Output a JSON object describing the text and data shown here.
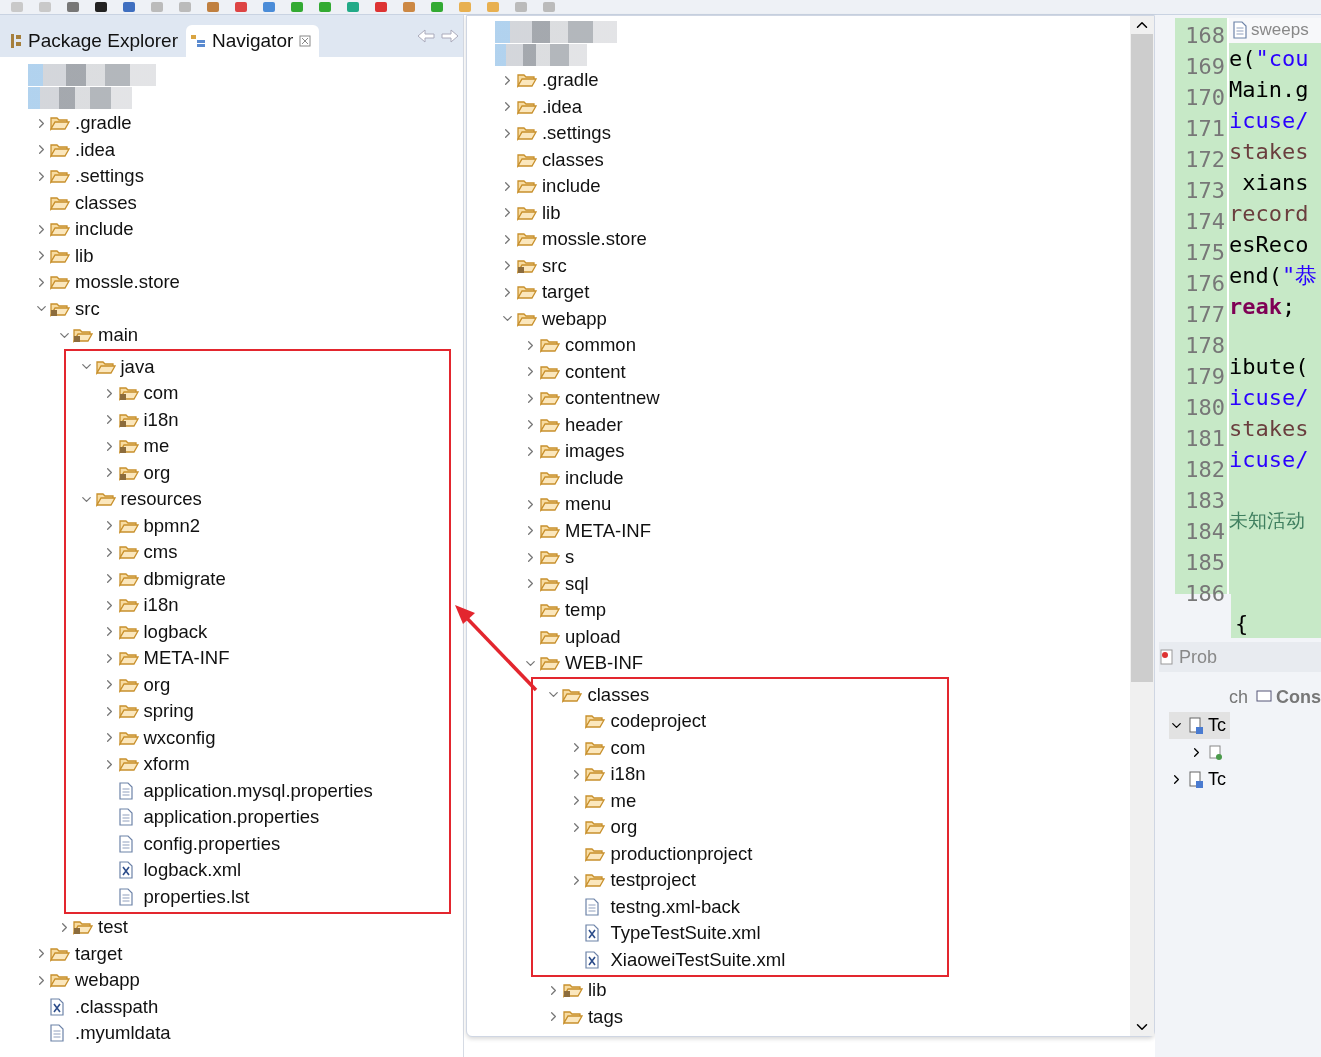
{
  "left_panel": {
    "tabs": [
      {
        "label": "Package Explorer",
        "selected": false
      },
      {
        "label": "Navigator",
        "selected": true
      }
    ],
    "redacted_rows": [
      {
        "kind": "project"
      },
      {
        "kind": "path"
      }
    ],
    "tree": [
      {
        "label": ".gradle",
        "kind": "folder",
        "expanded": false
      },
      {
        "label": ".idea",
        "kind": "folder",
        "expanded": false
      },
      {
        "label": ".settings",
        "kind": "folder",
        "expanded": false
      },
      {
        "label": "classes",
        "kind": "folder"
      },
      {
        "label": "include",
        "kind": "folder",
        "expanded": false
      },
      {
        "label": "lib",
        "kind": "folder",
        "expanded": false
      },
      {
        "label": "mossle.store",
        "kind": "folder",
        "expanded": false
      },
      {
        "label": "src",
        "kind": "source_folder",
        "expanded": true,
        "children": [
          {
            "label": "main",
            "kind": "source_folder",
            "expanded": true,
            "children": [
              {
                "label": "java",
                "kind": "folder",
                "expanded": true,
                "highlighted": true,
                "children": [
                  {
                    "label": "com",
                    "kind": "source_folder",
                    "expanded": false
                  },
                  {
                    "label": "i18n",
                    "kind": "source_folder",
                    "expanded": false
                  },
                  {
                    "label": "me",
                    "kind": "source_folder",
                    "expanded": false
                  },
                  {
                    "label": "org",
                    "kind": "source_folder",
                    "expanded": false
                  }
                ]
              },
              {
                "label": "resources",
                "kind": "folder",
                "expanded": true,
                "highlighted": true,
                "children": [
                  {
                    "label": "bpmn2",
                    "kind": "folder",
                    "expanded": false
                  },
                  {
                    "label": "cms",
                    "kind": "folder",
                    "expanded": false
                  },
                  {
                    "label": "dbmigrate",
                    "kind": "folder",
                    "expanded": false
                  },
                  {
                    "label": "i18n",
                    "kind": "folder",
                    "expanded": false
                  },
                  {
                    "label": "logback",
                    "kind": "folder",
                    "expanded": false
                  },
                  {
                    "label": "META-INF",
                    "kind": "folder",
                    "expanded": false
                  },
                  {
                    "label": "org",
                    "kind": "folder",
                    "expanded": false
                  },
                  {
                    "label": "spring",
                    "kind": "folder",
                    "expanded": false
                  },
                  {
                    "label": "wxconfig",
                    "kind": "folder",
                    "expanded": false
                  },
                  {
                    "label": "xform",
                    "kind": "folder",
                    "expanded": false
                  },
                  {
                    "label": "application.mysql.properties",
                    "kind": "file"
                  },
                  {
                    "label": "application.properties",
                    "kind": "file"
                  },
                  {
                    "label": "config.properties",
                    "kind": "file"
                  },
                  {
                    "label": "logback.xml",
                    "kind": "xml_file"
                  },
                  {
                    "label": "properties.lst",
                    "kind": "file"
                  }
                ]
              }
            ]
          },
          {
            "label": "test",
            "kind": "source_folder",
            "expanded": false
          }
        ]
      },
      {
        "label": "target",
        "kind": "folder",
        "expanded": false
      },
      {
        "label": "webapp",
        "kind": "folder",
        "expanded": false
      },
      {
        "label": ".classpath",
        "kind": "xml_file"
      },
      {
        "label": ".myumldata",
        "kind": "file"
      }
    ]
  },
  "navigator_window": {
    "redacted_rows": [
      {
        "kind": "project"
      },
      {
        "kind": "path"
      }
    ],
    "tree": [
      {
        "label": ".gradle",
        "kind": "folder",
        "expanded": false
      },
      {
        "label": ".idea",
        "kind": "folder",
        "expanded": false
      },
      {
        "label": ".settings",
        "kind": "folder",
        "expanded": false
      },
      {
        "label": "classes",
        "kind": "folder"
      },
      {
        "label": "include",
        "kind": "folder",
        "expanded": false
      },
      {
        "label": "lib",
        "kind": "folder",
        "expanded": false
      },
      {
        "label": "mossle.store",
        "kind": "folder",
        "expanded": false
      },
      {
        "label": "src",
        "kind": "source_folder",
        "expanded": false
      },
      {
        "label": "target",
        "kind": "folder",
        "expanded": false
      },
      {
        "label": "webapp",
        "kind": "folder",
        "expanded": true,
        "children": [
          {
            "label": "common",
            "kind": "folder",
            "expanded": false
          },
          {
            "label": "content",
            "kind": "folder",
            "expanded": false
          },
          {
            "label": "contentnew",
            "kind": "folder",
            "expanded": false
          },
          {
            "label": "header",
            "kind": "folder",
            "expanded": false
          },
          {
            "label": "images",
            "kind": "folder",
            "expanded": false
          },
          {
            "label": "include",
            "kind": "folder"
          },
          {
            "label": "menu",
            "kind": "folder",
            "expanded": false
          },
          {
            "label": "META-INF",
            "kind": "folder",
            "expanded": false
          },
          {
            "label": "s",
            "kind": "folder",
            "expanded": false
          },
          {
            "label": "sql",
            "kind": "folder",
            "expanded": false
          },
          {
            "label": "temp",
            "kind": "folder"
          },
          {
            "label": "upload",
            "kind": "folder"
          },
          {
            "label": "WEB-INF",
            "kind": "folder",
            "expanded": true,
            "children": [
              {
                "label": "classes",
                "kind": "folder",
                "expanded": true,
                "highlighted": true,
                "children": [
                  {
                    "label": "codeproject",
                    "kind": "folder"
                  },
                  {
                    "label": "com",
                    "kind": "folder",
                    "expanded": false
                  },
                  {
                    "label": "i18n",
                    "kind": "folder",
                    "expanded": false
                  },
                  {
                    "label": "me",
                    "kind": "folder",
                    "expanded": false
                  },
                  {
                    "label": "org",
                    "kind": "folder",
                    "expanded": false
                  },
                  {
                    "label": "productionproject",
                    "kind": "folder"
                  },
                  {
                    "label": "testproject",
                    "kind": "folder",
                    "expanded": false
                  },
                  {
                    "label": "testng.xml-back",
                    "kind": "file"
                  },
                  {
                    "label": "TypeTestSuite.xml",
                    "kind": "xml_file"
                  },
                  {
                    "label": "XiaoweiTestSuite.xml",
                    "kind": "xml_file"
                  }
                ]
              },
              {
                "label": "lib",
                "kind": "source_folder",
                "expanded": false
              },
              {
                "label": "tags",
                "kind": "folder",
                "expanded": false
              }
            ]
          }
        ]
      }
    ]
  },
  "arrow": {
    "kind": "pointer"
  },
  "editor": {
    "tab": "sweeps",
    "lines": [
      {
        "number": "168"
      },
      {
        "number": "169",
        "code": [
          {
            "text": "e(",
            "kind": "plain"
          },
          {
            "text": "\"cou",
            "kind": "string"
          }
        ]
      },
      {
        "number": "170",
        "code": [
          {
            "text": "Main.g",
            "kind": "plain"
          }
        ]
      },
      {
        "number": "171",
        "code": [
          {
            "text": "icuse/",
            "kind": "string"
          }
        ]
      },
      {
        "number": "172",
        "code": [
          {
            "text": "stakes",
            "kind": "field"
          }
        ]
      },
      {
        "number": "173",
        "code": [
          {
            "text": " xians",
            "kind": "plain"
          }
        ]
      },
      {
        "number": "174",
        "code": [
          {
            "text": "record",
            "kind": "field"
          }
        ]
      },
      {
        "number": "175",
        "code": [
          {
            "text": "esReco",
            "kind": "plain"
          }
        ]
      },
      {
        "number": "176",
        "code": [
          {
            "text": "end(",
            "kind": "plain"
          },
          {
            "text": "\"恭",
            "kind": "string"
          }
        ]
      },
      {
        "number": "177",
        "code": [
          {
            "text": "reak",
            "kind": "keyword"
          },
          {
            "text": ";",
            "kind": "plain"
          }
        ]
      },
      {
        "number": "178"
      },
      {
        "number": "179",
        "code": [
          {
            "text": "ibute(",
            "kind": "plain"
          }
        ]
      },
      {
        "number": "180",
        "code": [
          {
            "text": "icuse/",
            "kind": "string"
          }
        ]
      },
      {
        "number": "181",
        "code": [
          {
            "text": "stakes",
            "kind": "field"
          }
        ]
      },
      {
        "number": "182",
        "code": [
          {
            "text": "icuse/",
            "kind": "string"
          }
        ]
      },
      {
        "number": "183"
      },
      {
        "number": "184",
        "code": [
          {
            "text": "未知活动",
            "kind": "comment"
          }
        ]
      },
      {
        "number": "185"
      },
      {
        "number": "186"
      }
    ],
    "trailing": "{"
  },
  "bottom_panel": {
    "tab": "Prob",
    "tabs_row": [
      "ch",
      "Cons"
    ],
    "tree": [
      {
        "label": "Tc",
        "expanded": true,
        "selected": true,
        "children": [
          {
            "expanded": false
          }
        ]
      },
      {
        "label": "Tc",
        "expanded": false,
        "selected": false
      }
    ]
  }
}
